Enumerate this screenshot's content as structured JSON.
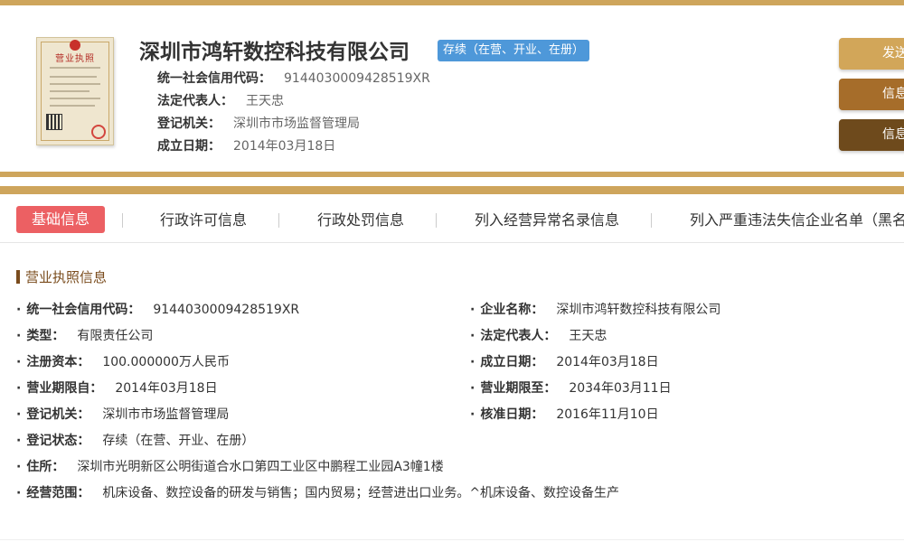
{
  "license_image": {
    "title": "营业执照"
  },
  "company": {
    "name": "深圳市鸿轩数控科技有限公司",
    "status": "存续（在营、开业、在册）"
  },
  "header_meta": [
    {
      "label": "统一社会信用代码：",
      "value": "9144030009428519XR"
    },
    {
      "label": "法定代表人：",
      "value": "王天忠"
    },
    {
      "label": "登记机关：",
      "value": "深圳市市场监督管理局"
    },
    {
      "label": "成立日期：",
      "value": "2014年03月18日"
    }
  ],
  "side_buttons": [
    "发送",
    "信息",
    "信息"
  ],
  "tabs": [
    {
      "label": "基础信息",
      "active": true
    },
    {
      "label": "行政许可信息",
      "active": false
    },
    {
      "label": "行政处罚信息",
      "active": false
    },
    {
      "label": "列入经营异常名录信息",
      "active": false
    },
    {
      "label": "列入严重违法失信企业名单（黑名",
      "active": false
    }
  ],
  "section": {
    "title": "营业执照信息"
  },
  "fields": [
    {
      "label": "统一社会信用代码：",
      "value": "9144030009428519XR"
    },
    {
      "label": "企业名称：",
      "value": "深圳市鸿轩数控科技有限公司"
    },
    {
      "label": "类型：",
      "value": "有限责任公司"
    },
    {
      "label": "法定代表人：",
      "value": "王天忠"
    },
    {
      "label": "注册资本：",
      "value": "100.000000万人民币"
    },
    {
      "label": "成立日期：",
      "value": "2014年03月18日"
    },
    {
      "label": "营业期限自：",
      "value": "2014年03月18日"
    },
    {
      "label": "营业期限至：",
      "value": "2034年03月11日"
    },
    {
      "label": "登记机关：",
      "value": "深圳市市场监督管理局"
    },
    {
      "label": "核准日期：",
      "value": "2016年11月10日"
    },
    {
      "label": "登记状态：",
      "value": "存续（在营、开业、在册）"
    },
    {
      "label": "住所：",
      "value": "深圳市光明新区公明街道合水口第四工业区中鹏程工业园A3幢1楼"
    },
    {
      "label": "经营范围：",
      "value": "机床设备、数控设备的研发与销售；国内贸易；经营进出口业务。^机床设备、数控设备生产"
    }
  ],
  "colors": {
    "gold": "#cea55c",
    "tab_active": "#ec6063",
    "status_badge": "#4e98d9",
    "section_title": "#7a4c1d"
  }
}
